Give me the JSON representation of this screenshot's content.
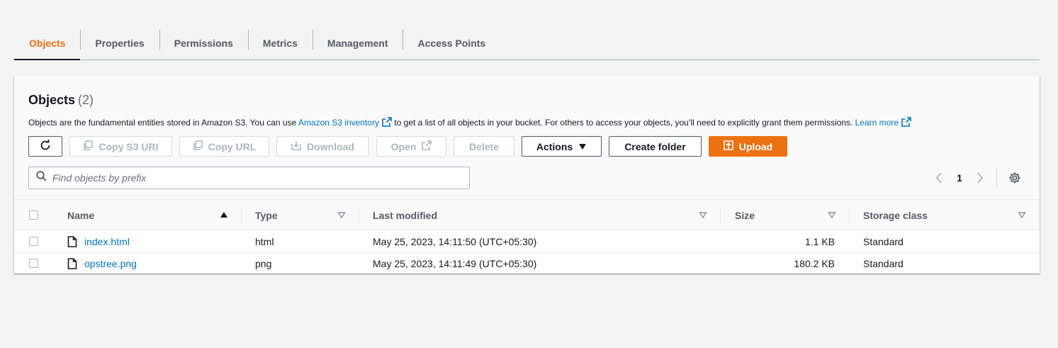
{
  "tabs": [
    {
      "label": "Objects",
      "active": true
    },
    {
      "label": "Properties"
    },
    {
      "label": "Permissions"
    },
    {
      "label": "Metrics"
    },
    {
      "label": "Management"
    },
    {
      "label": "Access Points"
    }
  ],
  "panel": {
    "title": "Objects",
    "count": "(2)",
    "desc_1": "Objects are the fundamental entities stored in Amazon S3. You can use ",
    "desc_link_1": "Amazon S3 inventory",
    "desc_2": " to get a list of all objects in your bucket. For others to access your objects, you’ll need to explicitly grant them permissions. ",
    "desc_link_2": "Learn more"
  },
  "toolbar": {
    "refresh_icon": "refresh-icon",
    "copy_s3_uri": "Copy S3 URI",
    "copy_url": "Copy URL",
    "download": "Download",
    "open": "Open",
    "delete": "Delete",
    "actions": "Actions",
    "create_folder": "Create folder",
    "upload": "Upload"
  },
  "search": {
    "placeholder": "Find objects by prefix",
    "value": ""
  },
  "pagination": {
    "current_page": "1"
  },
  "table": {
    "columns": {
      "name": "Name",
      "type": "Type",
      "last_modified": "Last modified",
      "size": "Size",
      "storage_class": "Storage class"
    },
    "rows": [
      {
        "name": "index.html",
        "type": "html",
        "last_modified": "May 25, 2023, 14:11:50 (UTC+05:30)",
        "size": "1.1 KB",
        "storage_class": "Standard"
      },
      {
        "name": "opstree.png",
        "type": "png",
        "last_modified": "May 25, 2023, 14:11:49 (UTC+05:30)",
        "size": "180.2 KB",
        "storage_class": "Standard"
      }
    ]
  },
  "colors": {
    "accent": "#ec7211",
    "link": "#0073bb",
    "text": "#16191f",
    "muted": "#545b64",
    "disabled": "#aab7b8",
    "background": "#f2f3f3"
  }
}
